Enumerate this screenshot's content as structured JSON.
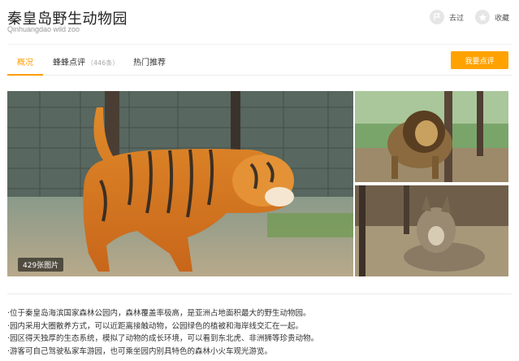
{
  "header": {
    "title": "秦皇岛野生动物园",
    "subtitle": "Qinhuangdao wild zoo"
  },
  "actions": {
    "been_label": "去过",
    "favorite_label": "收藏"
  },
  "tabs": [
    {
      "label": "概况"
    },
    {
      "label": "蜂蜂点评",
      "count": "（446条）"
    },
    {
      "label": "热门推荐"
    }
  ],
  "review_button_label": "我要点评",
  "photos": {
    "count_label": "429张图片"
  },
  "description": [
    "·位于秦皇岛海滨国家森林公园内，森林覆盖率极高，是亚洲占地面积最大的野生动物园。",
    "·园内采用大圈散养方式，可以近距离接触动物，公园绿色的植被和海岸线交汇在一起。",
    "·园区得天独厚的生态系统，模拟了动物的成长环境，可以看到东北虎、非洲狮等珍贵动物。",
    "·游客可自己驾驶私家车游园，也可乘坐园内别具特色的森林小火车观光游览。"
  ],
  "colors": {
    "accent": "#ffa200",
    "tab_active": "#ff9d00"
  }
}
